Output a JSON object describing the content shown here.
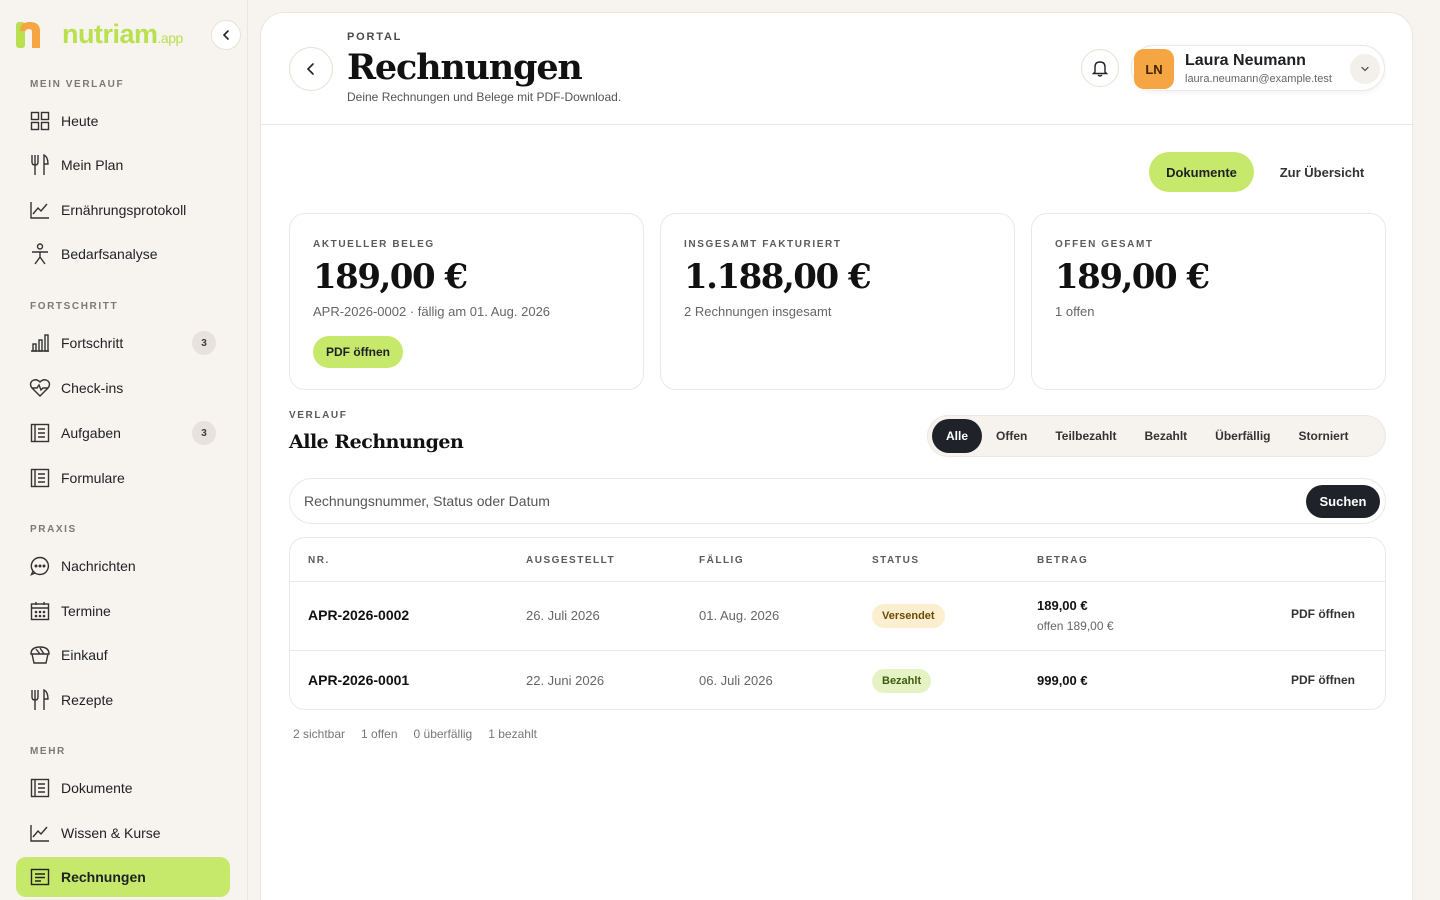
{
  "brand": {
    "name": "nutriam",
    "suffix": ".app"
  },
  "sidebar": {
    "sections": [
      {
        "label": "MEIN VERLAUF"
      },
      {
        "label": "FORTSCHRITT"
      },
      {
        "label": "PRAXIS"
      },
      {
        "label": "MEHR"
      }
    ],
    "items": [
      {
        "label": "Heute",
        "icon": "grid-icon"
      },
      {
        "label": "Mein Plan",
        "icon": "fork-knife-icon"
      },
      {
        "label": "Ernährungsprotokoll",
        "icon": "line-chart-icon"
      },
      {
        "label": "Bedarfsanalyse",
        "icon": "person-icon"
      },
      {
        "label": "Fortschritt",
        "icon": "bar-chart-icon",
        "badge": "3"
      },
      {
        "label": "Check-ins",
        "icon": "heart-pulse-icon"
      },
      {
        "label": "Aufgaben",
        "icon": "list-icon",
        "badge": "3"
      },
      {
        "label": "Formulare",
        "icon": "form-icon"
      },
      {
        "label": "Nachrichten",
        "icon": "chat-icon"
      },
      {
        "label": "Termine",
        "icon": "calendar-icon"
      },
      {
        "label": "Einkauf",
        "icon": "basket-icon"
      },
      {
        "label": "Rezepte",
        "icon": "fork-knife-icon"
      },
      {
        "label": "Dokumente",
        "icon": "document-icon"
      },
      {
        "label": "Wissen & Kurse",
        "icon": "line-chart-icon"
      },
      {
        "label": "Rechnungen",
        "icon": "receipt-icon"
      }
    ]
  },
  "header": {
    "eyebrow": "PORTAL",
    "title": "Rechnungen",
    "subtitle": "Deine Rechnungen und Belege mit PDF-Download."
  },
  "user": {
    "initials": "LN",
    "name": "Laura Neumann",
    "email": "laura.neumann@example.test"
  },
  "actions": {
    "documents": "Dokumente",
    "overview": "Zur Übersicht"
  },
  "stats": [
    {
      "label": "AKTUELLER BELEG",
      "value": "189,00 €",
      "sub": "APR-2026-0002 · fällig am 01. Aug. 2026",
      "button": "PDF öffnen"
    },
    {
      "label": "INSGESAMT FAKTURIERT",
      "value": "1.188,00 €",
      "sub": "2 Rechnungen insgesamt"
    },
    {
      "label": "OFFEN GESAMT",
      "value": "189,00 €",
      "sub": "1 offen"
    }
  ],
  "history": {
    "eyebrow": "VERLAUF",
    "title": "Alle Rechnungen"
  },
  "filters": [
    "Alle",
    "Offen",
    "Teilbezahlt",
    "Bezahlt",
    "Überfällig",
    "Storniert"
  ],
  "search": {
    "placeholder": "Rechnungsnummer, Status oder Datum",
    "button": "Suchen"
  },
  "table": {
    "headers": {
      "nr": "NR.",
      "issued": "AUSGESTELLT",
      "due": "FÄLLIG",
      "status": "STATUS",
      "amount": "BETRAG"
    },
    "rows": [
      {
        "nr": "APR-2026-0002",
        "issued": "26. Juli 2026",
        "due": "01. Aug. 2026",
        "status": "Versendet",
        "amount": "189,00 €",
        "open": "offen 189,00 €",
        "action": "PDF öffnen"
      },
      {
        "nr": "APR-2026-0001",
        "issued": "22. Juni 2026",
        "due": "06. Juli 2026",
        "status": "Bezahlt",
        "amount": "999,00 €",
        "action": "PDF öffnen"
      }
    ]
  },
  "summary": [
    "2 sichtbar",
    "1 offen",
    "0 überfällig",
    "1 bezahlt"
  ],
  "colors": {
    "accent": "#c7e96b",
    "brand_orange": "#f5a542",
    "dark": "#20222a"
  }
}
